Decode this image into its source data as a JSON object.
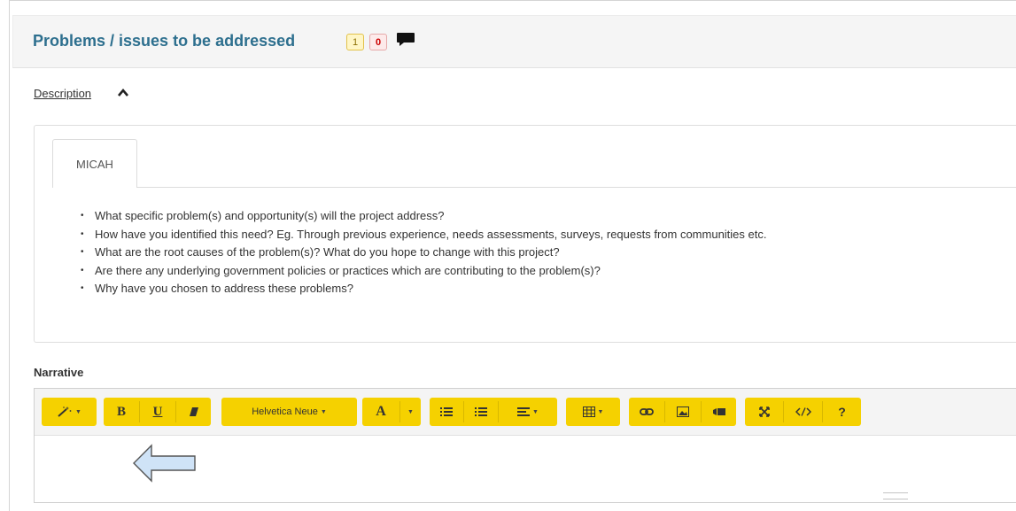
{
  "panel": {
    "title": "Problems / issues to be addressed",
    "badge_yellow": "1",
    "badge_red": "0"
  },
  "description": {
    "toggle_label": "Description",
    "tab_label": "MICAH",
    "questions": [
      "What specific problem(s) and opportunity(s) will the project address?",
      "How have you identified this need? Eg. Through previous experience, needs assessments, surveys, requests from communities etc.",
      "What are the root causes of the problem(s)? What do you hope to change with this project?",
      "Are there any underlying government policies or practices which are contributing to the problem(s)?",
      "Why have you chosen to address these problems?"
    ]
  },
  "narrative": {
    "label": "Narrative",
    "font_select": "Helvetica Neue",
    "toolbar": {
      "bold": "B",
      "underline": "U",
      "font_color": "A",
      "help": "?"
    }
  },
  "colors": {
    "title": "#2d6f8e",
    "toolbar_button": "#f5d100",
    "header_bg": "#f5f5f5",
    "arrow_fill": "#cfe3f7"
  },
  "icons": [
    "comment-icon",
    "caret-up-icon",
    "magic-wand-icon",
    "eraser-icon",
    "unordered-list-icon",
    "ordered-list-icon",
    "align-icon",
    "table-icon",
    "link-icon",
    "picture-icon",
    "video-icon",
    "fullscreen-icon",
    "code-view-icon",
    "left-arrow-indicator"
  ]
}
